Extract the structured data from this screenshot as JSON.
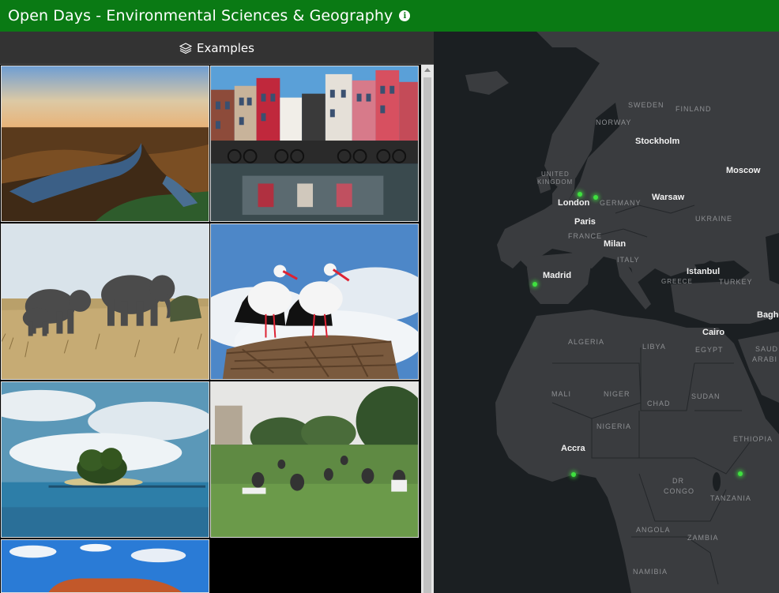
{
  "header": {
    "title": "Open Days - Environmental Sciences & Geography",
    "info_icon": "info-icon"
  },
  "panel": {
    "title": "Examples",
    "title_icon": "layers-icon",
    "items": [
      {
        "name": "wetland-river-photo"
      },
      {
        "name": "amsterdam-canal-houses-photo"
      },
      {
        "name": "elephants-savanna-photo"
      },
      {
        "name": "storks-nest-photo"
      },
      {
        "name": "tropical-island-photo"
      },
      {
        "name": "park-picnic-photo"
      },
      {
        "name": "uluru-rock-photo"
      }
    ]
  },
  "map": {
    "cities": {
      "stockholm": "Stockholm",
      "moscow": "Moscow",
      "london": "London",
      "warsaw": "Warsaw",
      "paris": "Paris",
      "milan": "Milan",
      "madrid": "Madrid",
      "istanbul": "Istanbul",
      "cairo": "Cairo",
      "baghdad": "Bagho",
      "accra": "Accra"
    },
    "countries": {
      "sweden": "SWEDEN",
      "finland": "FINLAND",
      "norway": "NORWAY",
      "uk_1": "UNITED",
      "uk_2": "KINGDOM",
      "germany": "GERMANY",
      "ukraine": "UKRAINE",
      "france": "FRANCE",
      "italy": "ITALY",
      "greece": "GREECE",
      "turkey": "TURKEY",
      "algeria": "ALGERIA",
      "libya": "LIBYA",
      "egypt": "EGYPT",
      "saudi_1": "SAUD",
      "saudi_2": "ARABI",
      "mali": "MALI",
      "niger": "NIGER",
      "chad": "CHAD",
      "sudan": "SUDAN",
      "nigeria": "NIGERIA",
      "ethiopia": "ETHIOPIA",
      "drc_1": "DR",
      "drc_2": "CONGO",
      "tanzania": "TANZANIA",
      "angola": "ANGOLA",
      "zambia": "ZAMBIA",
      "namibia": "NAMIBIA"
    },
    "marker_color": "#3fe13f"
  },
  "colors": {
    "header_bg": "#0a7a14",
    "panel_bg": "#333333",
    "map_water": "#1b1f22",
    "map_land": "#3a3c3f"
  }
}
